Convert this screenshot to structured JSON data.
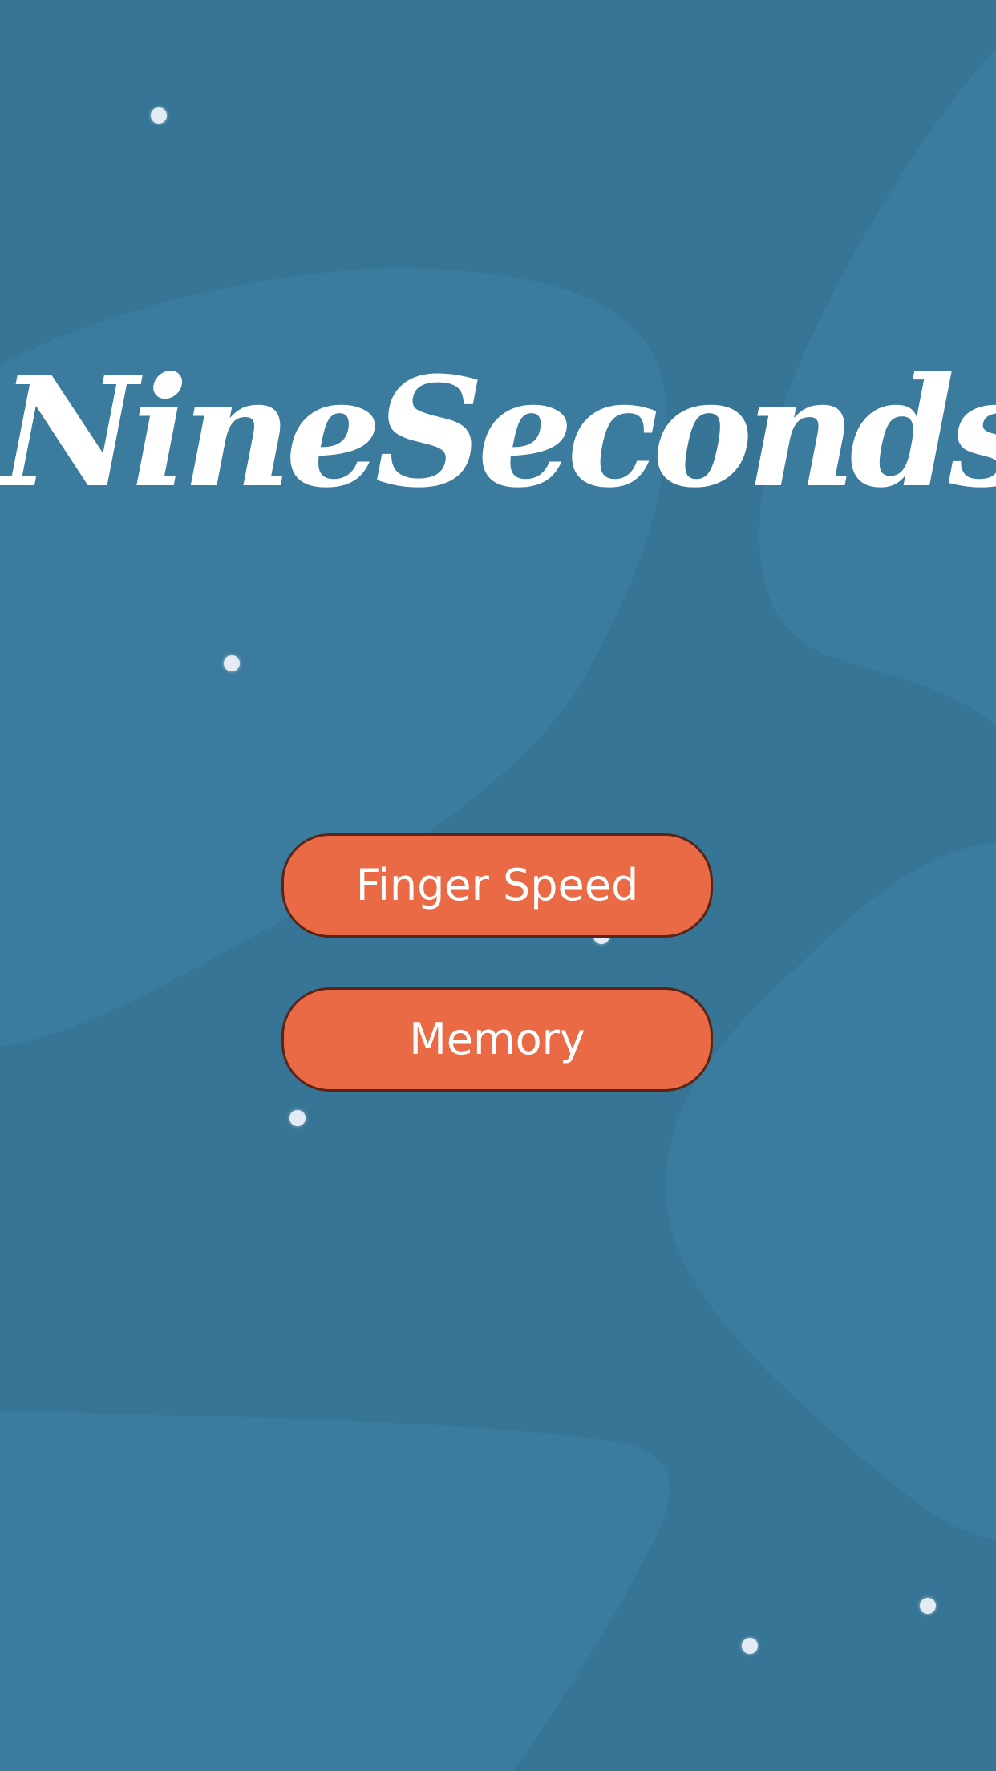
{
  "app": {
    "title": "NineSeconds"
  },
  "menu": {
    "finger_speed_label": "Finger Speed",
    "memory_label": "Memory"
  },
  "colors": {
    "background": "#367596",
    "background_blob": "#3b7b9d",
    "button_fill": "#e96a45",
    "button_border": "#5a2417",
    "text": "#ffffff",
    "dot": "#e3ecf4"
  }
}
